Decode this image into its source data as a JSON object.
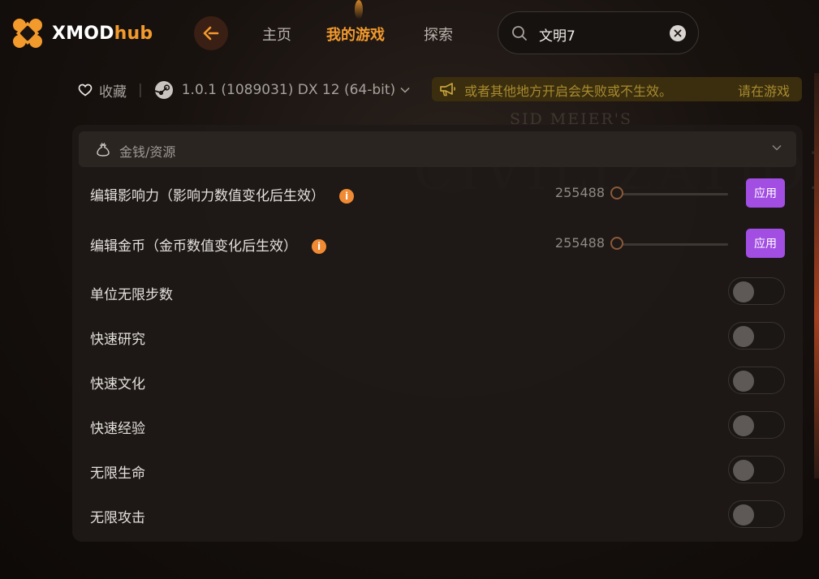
{
  "brand": {
    "logo_text_a": "XMOD",
    "logo_text_b": "hub",
    "accent": "#f39a2d"
  },
  "nav": {
    "back_icon": "back-arrow-icon",
    "items": [
      {
        "label": "主页",
        "active": false
      },
      {
        "label": "我的游戏",
        "active": true
      },
      {
        "label": "探索",
        "active": false
      }
    ]
  },
  "search": {
    "value": "文明7",
    "icon": "search-icon",
    "clear_icon": "close-icon"
  },
  "game_info": {
    "favorite_label": "收藏",
    "platform_icon": "steam-icon",
    "version": "1.0.1  (1089031)  DX 12 (64-bit)"
  },
  "notice": {
    "text_left": "或者其他地方开启会失败或不生效。",
    "text_right": "请在游戏"
  },
  "background_art": {
    "line1": "SID MEIER'S",
    "line2": "CIVILIZATION"
  },
  "section": {
    "title": "金钱/资源",
    "icon": "money-bag-icon"
  },
  "options": [
    {
      "label": "编辑影响力（影响力数值变化后生效）",
      "type": "slider",
      "value": "255488",
      "info": "i",
      "apply": "应用"
    },
    {
      "label": "编辑金币（金币数值变化后生效）",
      "type": "slider",
      "value": "255488",
      "info": "i",
      "apply": "应用"
    },
    {
      "label": "单位无限步数",
      "type": "toggle",
      "on": false
    },
    {
      "label": "快速研究",
      "type": "toggle",
      "on": false
    },
    {
      "label": "快速文化",
      "type": "toggle",
      "on": false
    },
    {
      "label": "快速经验",
      "type": "toggle",
      "on": false
    },
    {
      "label": "无限生命",
      "type": "toggle",
      "on": false
    },
    {
      "label": "无限攻击",
      "type": "toggle",
      "on": false
    }
  ],
  "colors": {
    "apply_button": "#a24ee3",
    "info_dot": "#f08a33",
    "notice_bg": "#3a2e0f"
  }
}
